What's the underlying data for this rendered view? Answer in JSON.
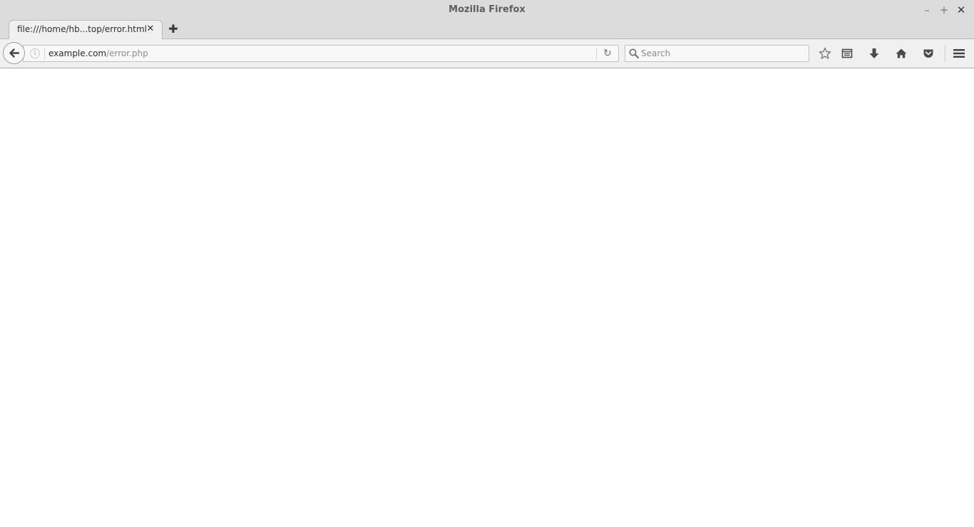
{
  "window": {
    "title": "Mozilla Firefox",
    "controls": {
      "minimize": "–",
      "maximize": "+",
      "close": "✕"
    }
  },
  "tabs": [
    {
      "label": "file:///home/hb...top/error.html",
      "close": "✕",
      "active": true
    }
  ],
  "newtab": {
    "symbol": "✚"
  },
  "navbar": {
    "back_symbol": "🡐",
    "info_symbol": "i",
    "url": {
      "host": "example.com",
      "path": "/error.php"
    },
    "reload_symbol": "↻",
    "search": {
      "placeholder": "Search",
      "value": ""
    }
  },
  "icons": {
    "bookmark": "bookmark-star-icon",
    "reading_list": "reading-list-icon",
    "downloads": "download-arrow-icon",
    "home": "home-icon",
    "pocket": "pocket-icon",
    "menu": "hamburger-menu-icon"
  },
  "colors": {
    "chrome": "#dcdcdc",
    "toolbar": "#f0f0f0",
    "icon": "#4a4a4a"
  }
}
